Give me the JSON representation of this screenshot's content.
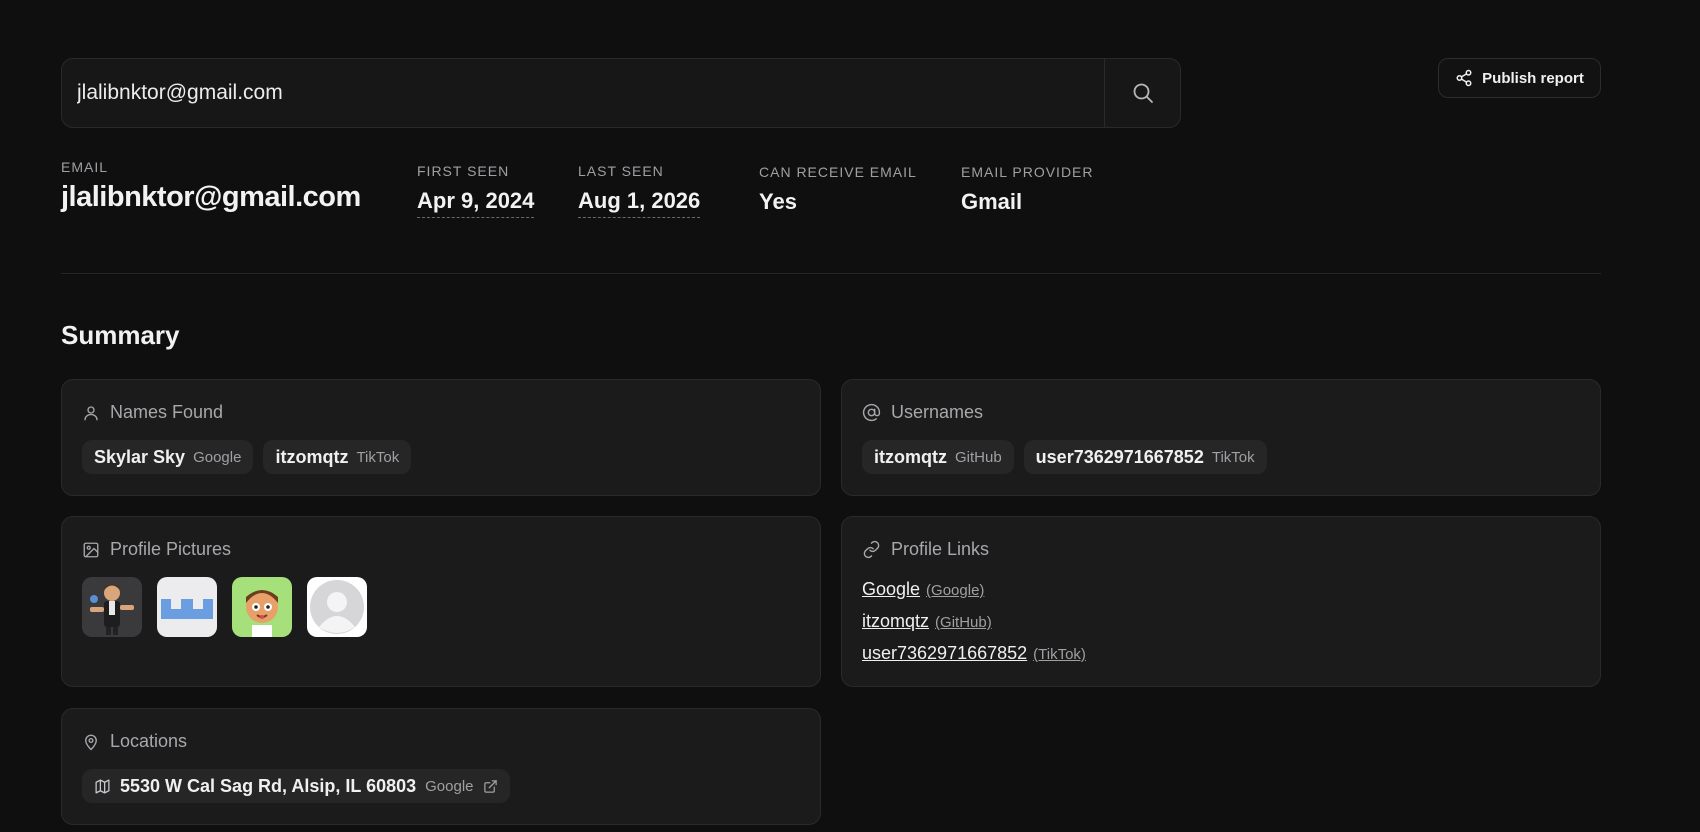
{
  "search": {
    "value": "jlalibnktor@gmail.com",
    "button_icon": "search-icon"
  },
  "publish": {
    "label": "Publish report",
    "icon": "share-icon"
  },
  "stats": {
    "email": {
      "label": "EMAIL",
      "value": "jlalibnktor@gmail.com"
    },
    "first_seen": {
      "label": "FIRST SEEN",
      "value": "Apr 9, 2024"
    },
    "last_seen": {
      "label": "LAST SEEN",
      "value": "Aug 1, 2026"
    },
    "can_receive": {
      "label": "CAN RECEIVE EMAIL",
      "value": "Yes"
    },
    "provider": {
      "label": "EMAIL PROVIDER",
      "value": "Gmail"
    }
  },
  "summary": {
    "title": "Summary",
    "names_found": {
      "title": "Names Found",
      "icon": "person-icon",
      "items": [
        {
          "name": "Skylar Sky",
          "source": "Google"
        },
        {
          "name": "itzomqtz",
          "source": "TikTok"
        }
      ]
    },
    "usernames": {
      "title": "Usernames",
      "icon": "at-sign-icon",
      "items": [
        {
          "name": "itzomqtz",
          "source": "GitHub"
        },
        {
          "name": "user7362971667852",
          "source": "TikTok"
        }
      ]
    },
    "profile_pictures": {
      "title": "Profile Pictures",
      "icon": "image-icon",
      "count": 4
    },
    "profile_links": {
      "title": "Profile Links",
      "icon": "link-icon",
      "items": [
        {
          "name": "Google",
          "source": "(Google)"
        },
        {
          "name": "itzomqtz",
          "source": "(GitHub)"
        },
        {
          "name": "user7362971667852",
          "source": "(TikTok)"
        }
      ]
    },
    "locations": {
      "title": "Locations",
      "icon": "map-pin-icon",
      "items": [
        {
          "address": "5530 W Cal Sag Rd, Alsip, IL 60803",
          "source": "Google"
        }
      ]
    }
  },
  "colors": {
    "background": "#0f0f10",
    "card": "#1b1b1c",
    "chip": "#262627",
    "muted_text": "#a0a0a4"
  }
}
